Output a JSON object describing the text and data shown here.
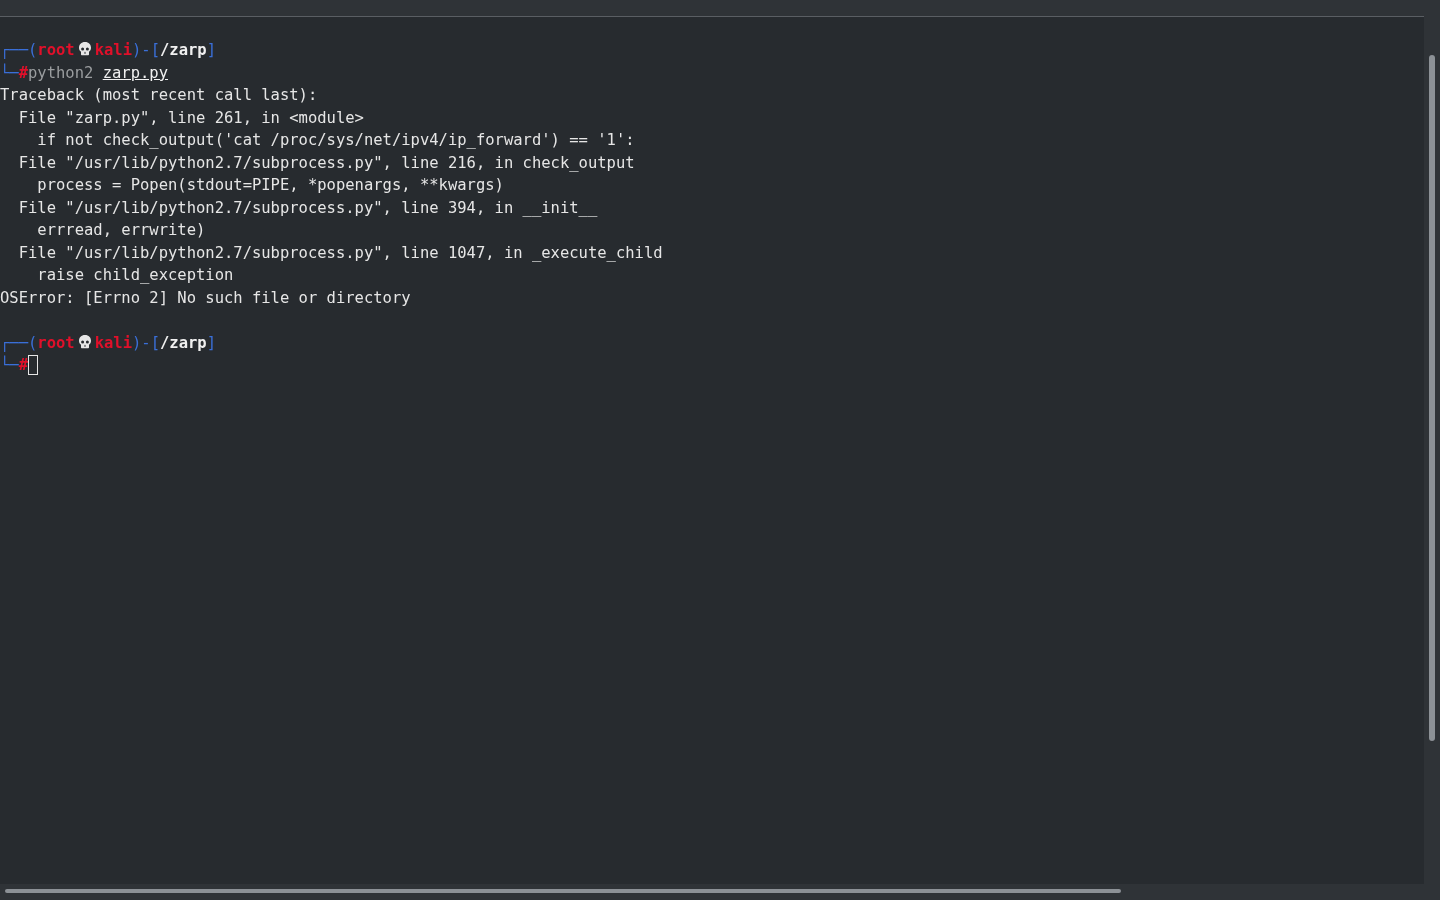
{
  "session": [
    {
      "prompt": {
        "corner_top": "┌──(",
        "user": "root",
        "host": "kali",
        "separator": ")-[",
        "path": "/zarp",
        "close": "]",
        "corner_bottom": "└─",
        "symbol": "#"
      },
      "command": {
        "program": "python2",
        "argument": "zarp.py"
      },
      "output": [
        "Traceback (most recent call last):",
        "  File \"zarp.py\", line 261, in <module>",
        "    if not check_output('cat /proc/sys/net/ipv4/ip_forward') == '1':",
        "  File \"/usr/lib/python2.7/subprocess.py\", line 216, in check_output",
        "    process = Popen(stdout=PIPE, *popenargs, **kwargs)",
        "  File \"/usr/lib/python2.7/subprocess.py\", line 394, in __init__",
        "    errread, errwrite)",
        "  File \"/usr/lib/python2.7/subprocess.py\", line 1047, in _execute_child",
        "    raise child_exception",
        "OSError: [Errno 2] No such file or directory"
      ]
    },
    {
      "prompt": {
        "corner_top": "┌──(",
        "user": "root",
        "host": "kali",
        "separator": ")-[",
        "path": "/zarp",
        "close": "]",
        "corner_bottom": "└─",
        "symbol": "#"
      },
      "cursor": true
    }
  ]
}
